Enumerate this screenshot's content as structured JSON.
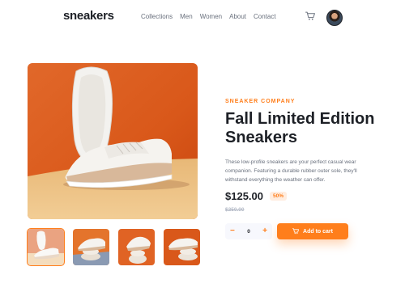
{
  "header": {
    "logo": "sneakers",
    "nav": [
      "Collections",
      "Men",
      "Women",
      "About",
      "Contact"
    ],
    "cart_icon": "cart-icon",
    "avatar_icon": "avatar"
  },
  "product": {
    "company": "SNEAKER COMPANY",
    "title": "Fall Limited Edition Sneakers",
    "description": "These low-profile sneakers are your perfect casual wear companion. Featuring a durable rubber outer sole, they'll withstand everything the weather can offer.",
    "price": "$125.00",
    "discount": "50%",
    "old_price": "$250.00",
    "quantity": "0",
    "minus_icon": "−",
    "plus_icon": "+",
    "add_to_cart_label": "Add to cart"
  },
  "gallery": {
    "selected_index": 0,
    "thumbnail_count": 4
  },
  "colors": {
    "accent": "#ff7e1b",
    "accent_pale": "#ffede0",
    "dark": "#1d2026",
    "grey": "#69707d"
  }
}
